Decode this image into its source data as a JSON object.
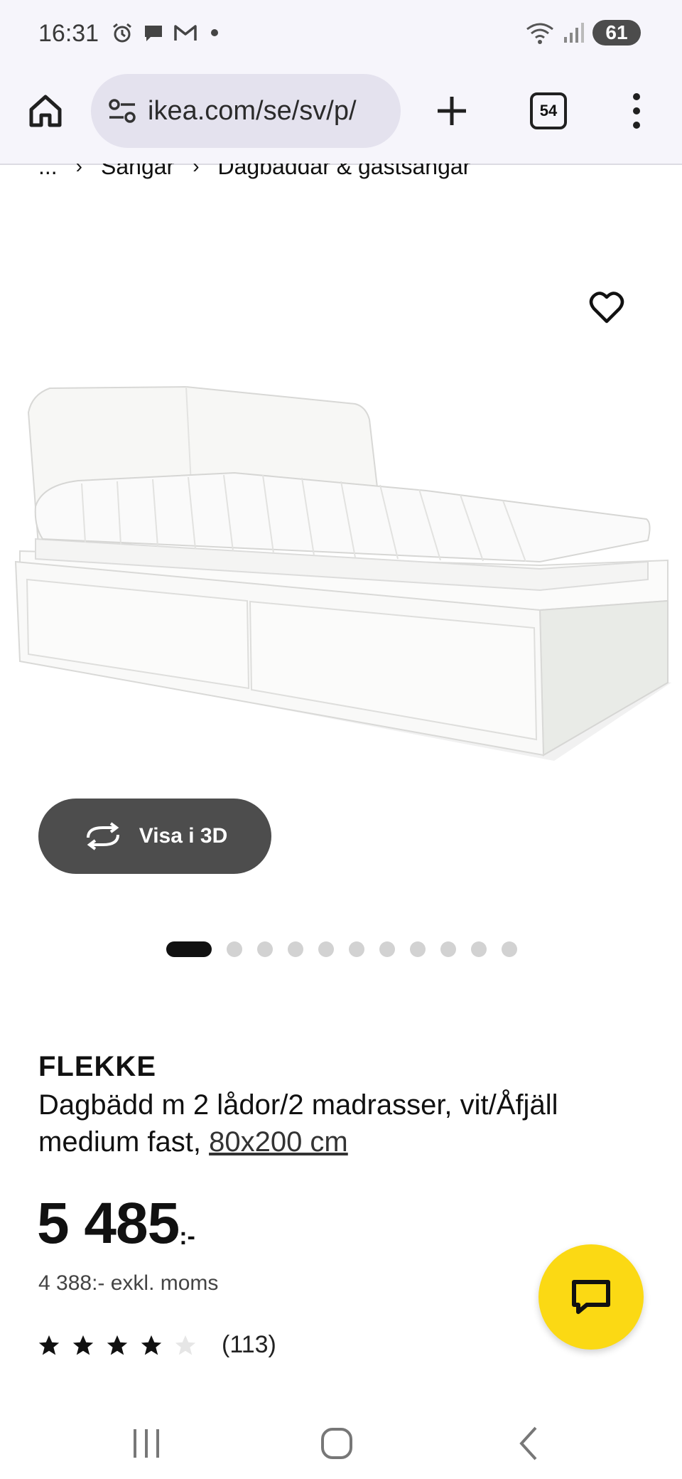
{
  "status_bar": {
    "time": "16:31",
    "battery": "61",
    "icons": [
      "alarm-icon",
      "chat-bubble-icon",
      "gmail-icon",
      "dot-icon",
      "wifi-icon",
      "signal-icon"
    ]
  },
  "browser": {
    "url": "ikea.com/se/sv/p/",
    "tab_count": "54",
    "icons": [
      "home-icon",
      "site-settings-icon",
      "plus-icon",
      "tabs-icon",
      "more-vert-icon"
    ]
  },
  "breadcrumb": {
    "items": [
      "...",
      "Sängar",
      "Dagbäddar & gästsängar"
    ]
  },
  "product": {
    "view_3d_label": "Visa i 3D",
    "image_count": 11,
    "active_image": 1,
    "brand": "FLEKKE",
    "description": "Dagbädd m 2 lådor/2 madrasser, vit/Åfjäll medium fast, ",
    "size_link": "80x200 cm",
    "price": "5 485",
    "price_suffix": ":-",
    "price_ex_vat": "4 388:- exkl. moms",
    "rating_value": 4,
    "rating_max": 5,
    "rating_count": "(113)"
  },
  "colors": {
    "chat_button": "#fbd914",
    "view_3d_button": "#4d4d4d",
    "browser_bar": "#f6f5fb",
    "url_box": "#e4e2ee"
  }
}
